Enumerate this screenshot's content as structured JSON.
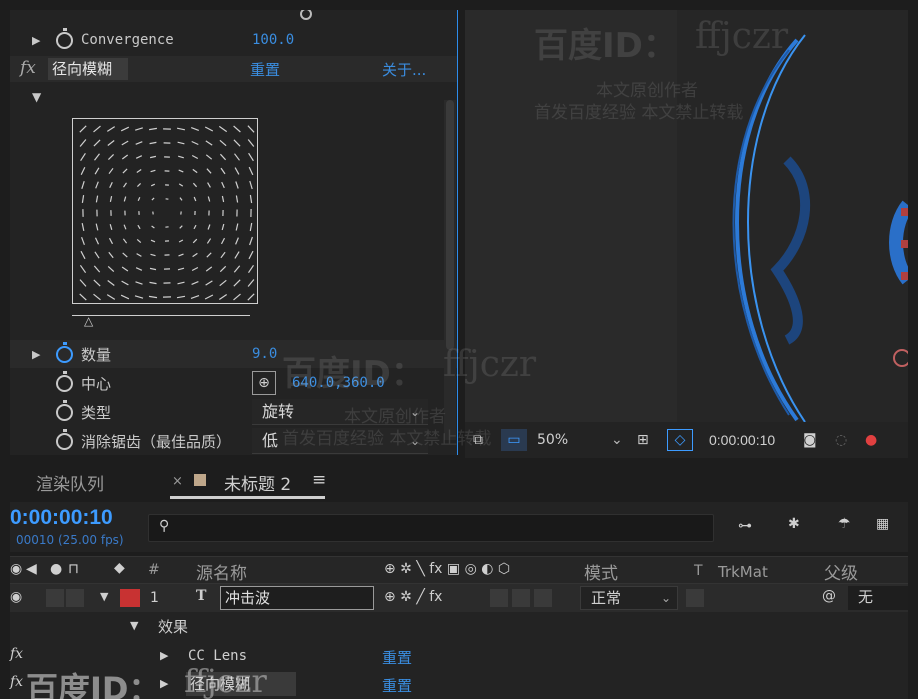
{
  "effect_controls": {
    "convergence_label": "Convergence",
    "convergence_value": "100.0",
    "effect_name": "径向模糊",
    "reset_label": "重置",
    "about_label": "关于...",
    "amount_label": "数量",
    "amount_value": "9.0",
    "center_label": "中心",
    "center_value": "640.0,360.0",
    "type_label": "类型",
    "type_value": "旋转",
    "antialias_label": "消除锯齿（最佳品质）",
    "antialias_value": "低"
  },
  "viewer": {
    "zoom": "50%",
    "timecode": "0:00:00:10"
  },
  "timeline": {
    "tab_render_queue": "渲染队列",
    "tab_comp": "未标题 2",
    "timecode": "0:00:00:10",
    "frames": "00010 (25.00 fps)",
    "search_placeholder": "",
    "columns": {
      "number": "#",
      "source_name": "源名称",
      "mode": "模式",
      "trkmat_t": "T",
      "trkmat": "TrkMat",
      "parent": "父级"
    },
    "layer": {
      "index": "1",
      "name": "冲击波",
      "mode": "正常",
      "parent": "无",
      "label_color": "#c83232"
    },
    "effects_group": "效果",
    "effects": [
      {
        "name": "CC Lens",
        "reset": "重置"
      },
      {
        "name": "径向模糊",
        "reset": "重置"
      }
    ]
  },
  "watermarks": {
    "brand": "百度ID：",
    "id": "ffjczr",
    "line1": "本文原创作者",
    "line2": "首发百度经验  本文禁止转载"
  },
  "colors": {
    "accent": "#3d9bff",
    "panel_border": "#2d8ceb"
  }
}
